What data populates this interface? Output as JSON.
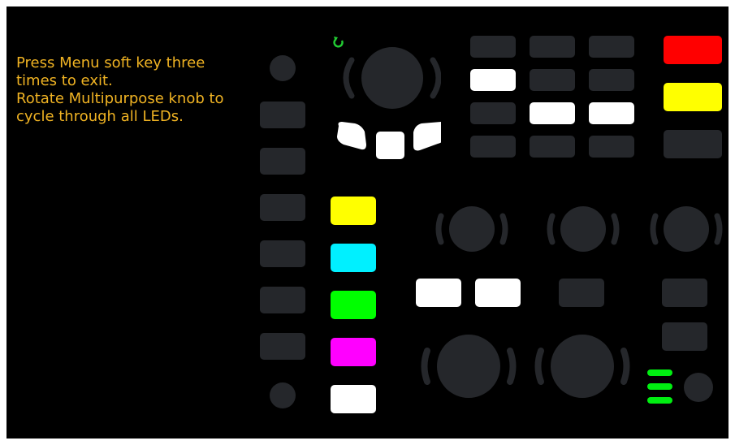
{
  "instructions": [
    "Press Menu soft key three",
    "times to exit.",
    "Rotate Multipurpose knob to",
    "cycle through all LEDs."
  ],
  "colors": {
    "background": "#000000",
    "text": "#f0b323",
    "off": "#25272b",
    "white": "#ffffff",
    "red": "#ff0000",
    "yellow": "#ffff00",
    "cyan": "#00f0ff",
    "green": "#00ff00",
    "magenta": "#ff00ff",
    "led_green": "#00ee11",
    "refresh_icon": "#22cc33"
  },
  "leds": {
    "grid_row1": [
      "off",
      "off",
      "off"
    ],
    "grid_row2": [
      "white",
      "off",
      "off"
    ],
    "grid_row3": [
      "off",
      "white",
      "white"
    ],
    "grid_row4": [
      "off",
      "off",
      "off"
    ],
    "right_column": [
      "red",
      "yellow",
      "off"
    ],
    "channel_keys": [
      "yellow",
      "cyan",
      "green",
      "magenta",
      "white"
    ],
    "nav_keys": [
      "white",
      "white",
      "white"
    ],
    "middle_keys": [
      "white",
      "white",
      "off"
    ],
    "right_stack": [
      "off",
      "off"
    ],
    "level_bars": [
      "green",
      "green",
      "green"
    ]
  },
  "icons": {
    "refresh": "refresh-icon"
  }
}
